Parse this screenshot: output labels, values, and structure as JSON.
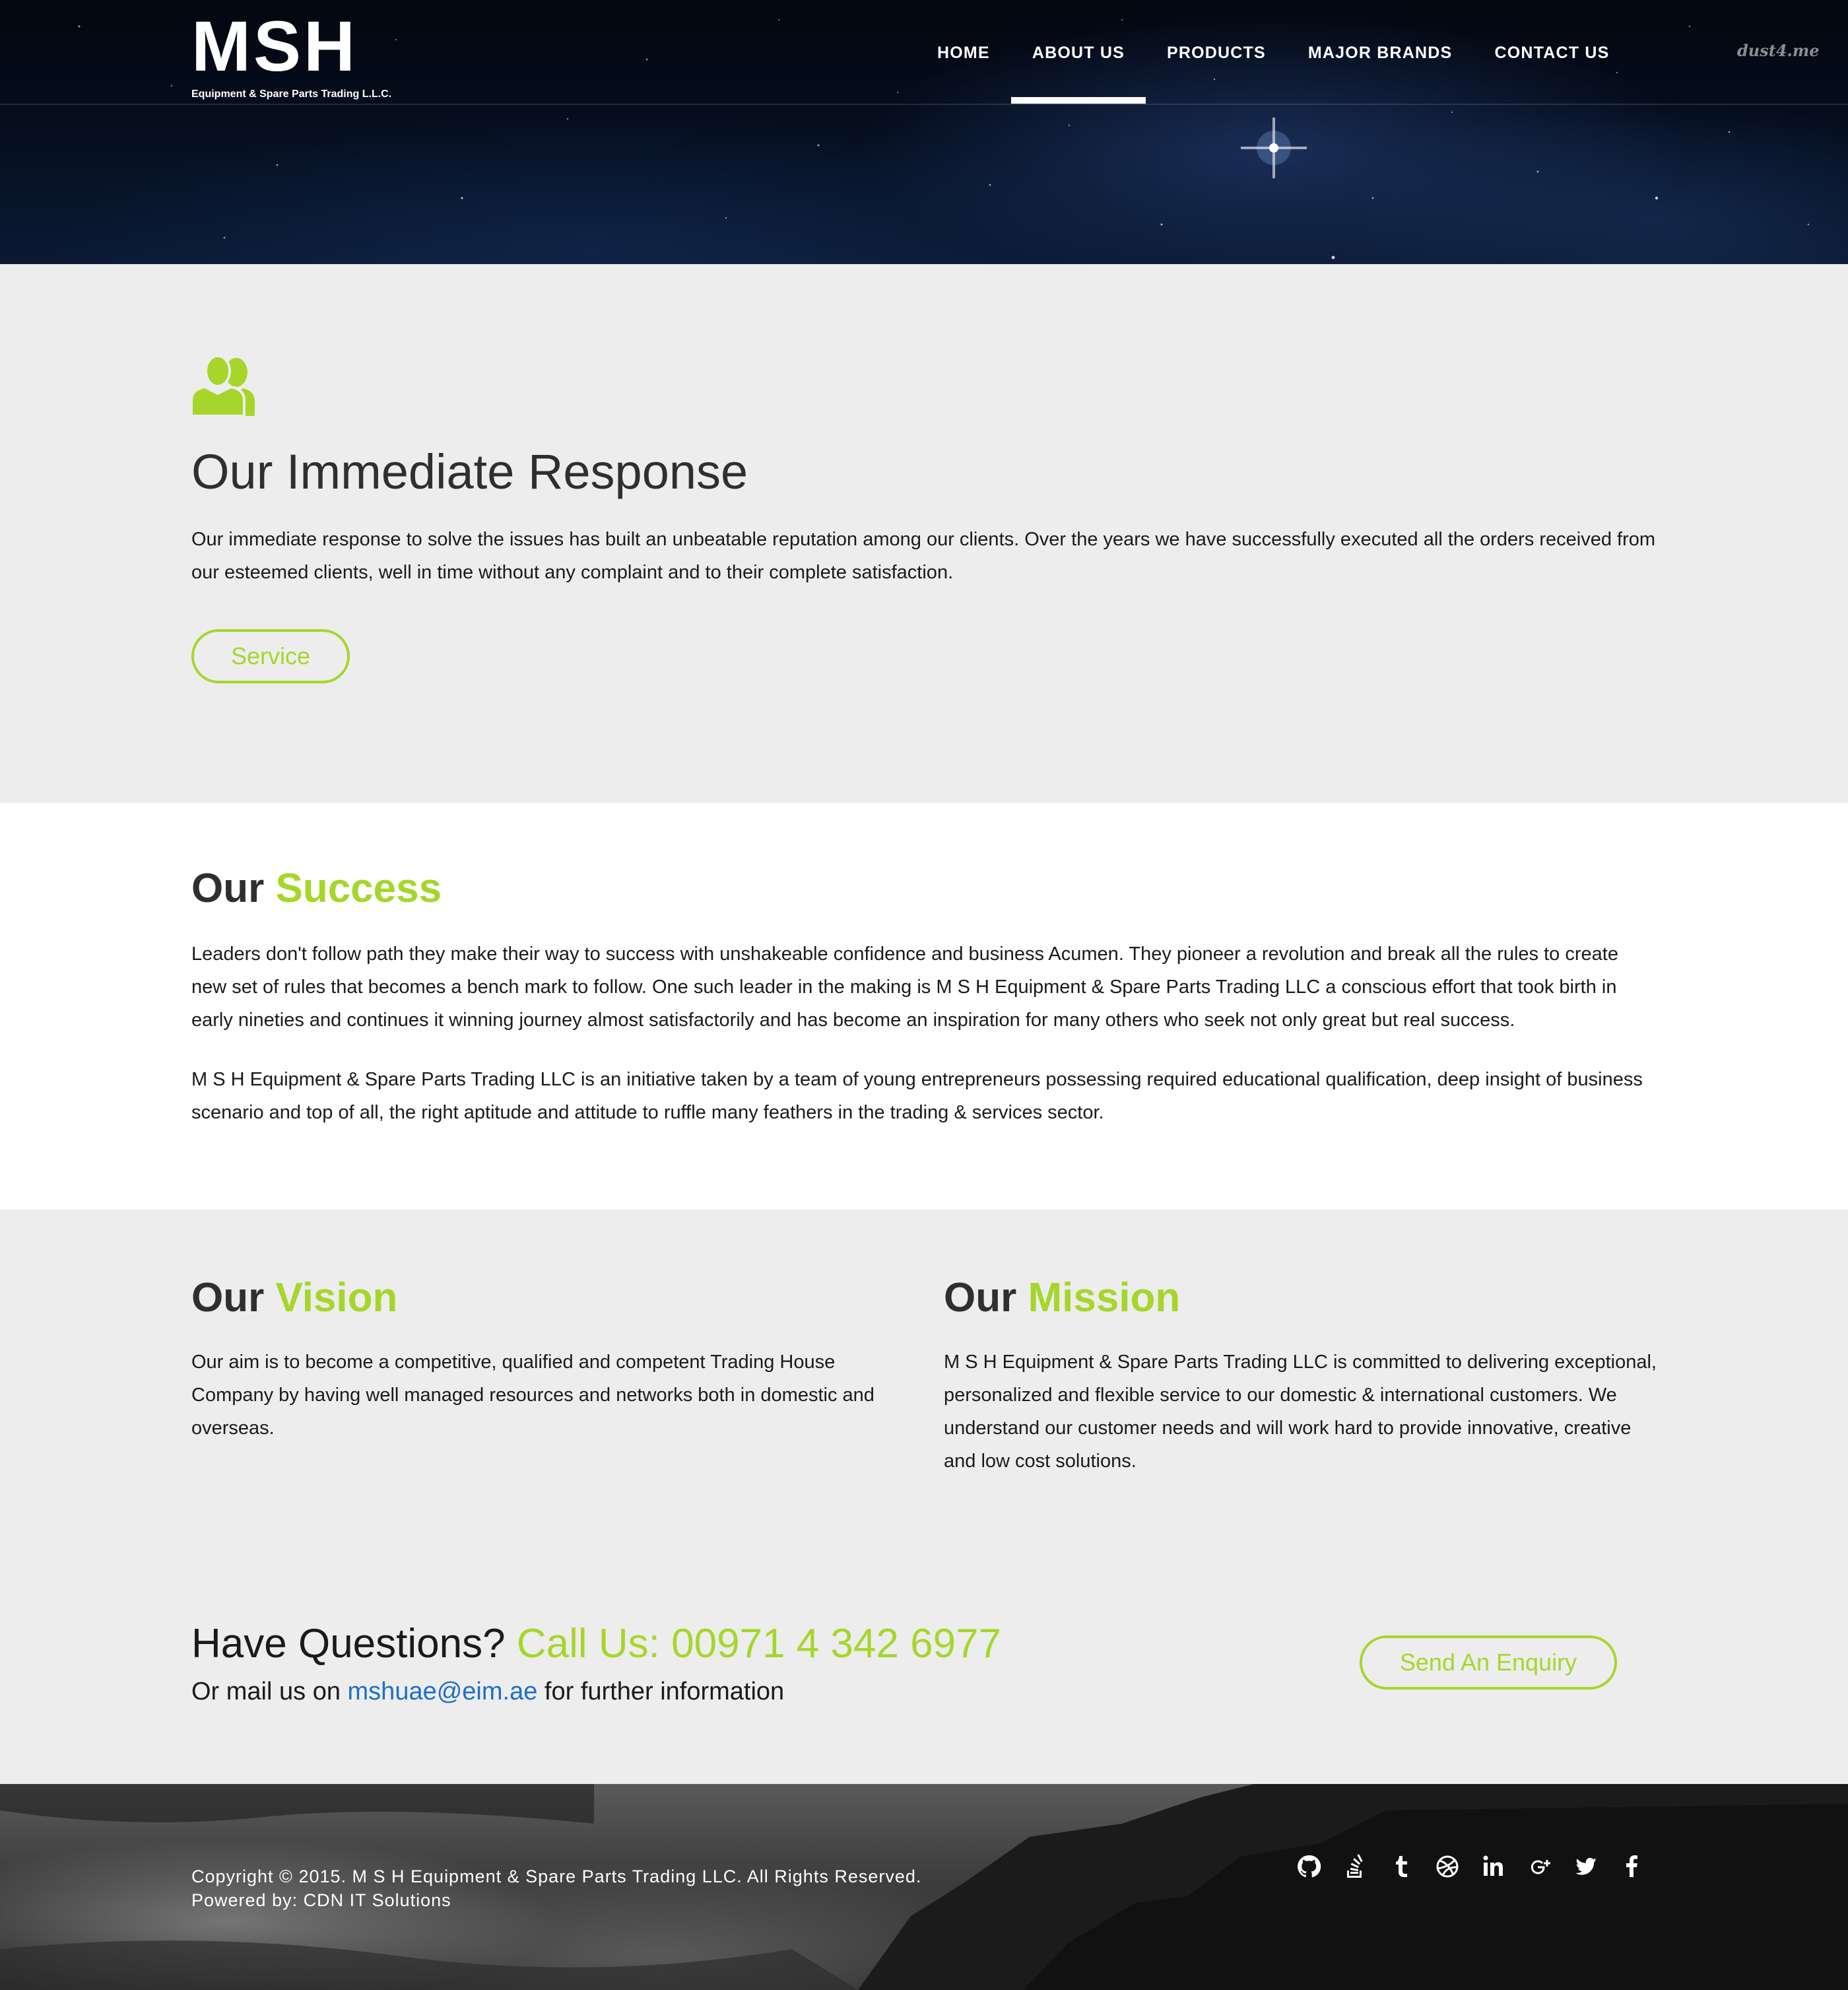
{
  "header": {
    "logo_main": "MSH",
    "logo_sub": "Equipment & Spare Parts Trading L.L.C.",
    "nav": [
      {
        "label": "HOME",
        "active": false
      },
      {
        "label": "ABOUT US",
        "active": true
      },
      {
        "label": "PRODUCTS",
        "active": false
      },
      {
        "label": "MAJOR BRANDS",
        "active": false
      },
      {
        "label": "CONTACT US",
        "active": false
      }
    ],
    "corner_link": "dust4.me"
  },
  "response": {
    "icon": "users-icon",
    "title": "Our Immediate Response",
    "text": "Our immediate response to solve the issues has built an unbeatable reputation among our clients. Over the years we have successfully executed all the orders received from our esteemed clients, well in time without any complaint and to their complete satisfaction.",
    "button": "Service"
  },
  "success": {
    "title_a": "Our",
    "title_b": "Success",
    "p1": "Leaders don't follow path they make their way to success with unshakeable confidence and business Acumen. They pioneer a revolution and break all the rules to create new set of rules that becomes a bench mark to follow. One such leader in the making is M S H Equipment & Spare Parts Trading LLC a conscious effort that took birth in early nineties and continues it winning journey almost satisfactorily and has become an inspiration for many others who seek not only great but real success.",
    "p2": "M S H Equipment & Spare Parts Trading LLC is an initiative taken by a team of young entrepreneurs possessing required educational qualification, deep insight of business scenario and top of all, the right aptitude and attitude to ruffle many feathers in the trading & services sector."
  },
  "vision": {
    "title_a": "Our",
    "title_b": "Vision",
    "text": "Our aim is to become a competitive, qualified and competent Trading House Company by having well managed resources and networks both in domestic and overseas."
  },
  "mission": {
    "title_a": "Our",
    "title_b": "Mission",
    "text": "M S H Equipment & Spare Parts Trading LLC is committed to delivering exceptional, personalized and flexible service to our domestic & international customers. We understand our customer needs and will work hard to provide innovative, creative and low cost solutions."
  },
  "contact": {
    "question": "Have Questions?",
    "call": "Call Us: 00971 4 342 6977",
    "mail_prefix": "Or mail us on",
    "email": "mshuae@eim.ae",
    "mail_suffix": "for further information",
    "button": "Send An Enquiry"
  },
  "footer": {
    "copyright": "Copyright © 2015. M S H Equipment & Spare Parts Trading LLC. All Rights Reserved.",
    "powered": "Powered by: CDN IT Solutions",
    "socials": [
      "github-icon",
      "stackoverflow-icon",
      "tumblr-icon",
      "dribbble-icon",
      "linkedin-icon",
      "google-plus-icon",
      "twitter-icon",
      "facebook-icon"
    ]
  },
  "colors": {
    "accent": "#a6d62b",
    "link": "#1f6fc4",
    "light_bg": "#ededed"
  }
}
